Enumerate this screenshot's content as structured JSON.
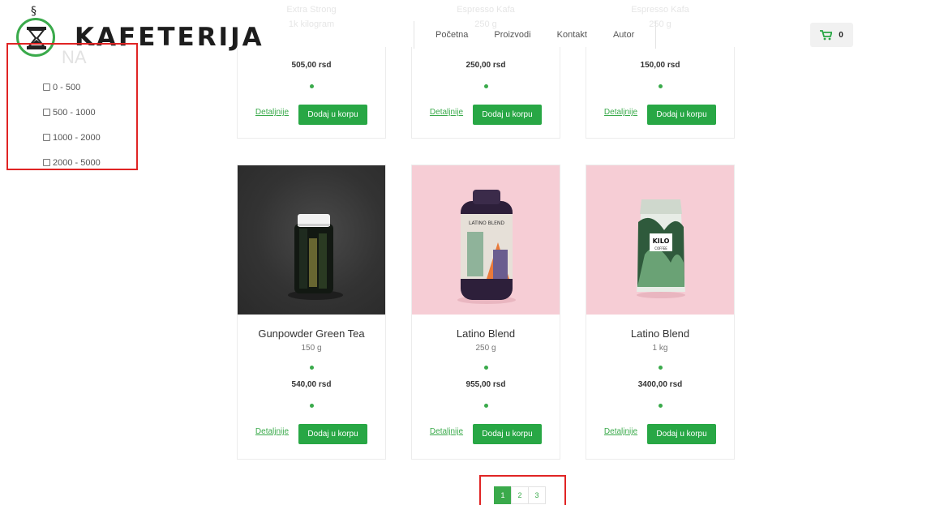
{
  "brand": {
    "logo_text": "KAFETERIJA",
    "logo_icon": "coffee-hourglass-icon",
    "accent": "#3aaa4b"
  },
  "nav": {
    "items": [
      "Početna",
      "Proizvodi",
      "Kontakt",
      "Autor"
    ]
  },
  "cart": {
    "icon": "cart-icon",
    "count": "0"
  },
  "filter": {
    "heading": "NA",
    "ranges": [
      "0 - 500",
      "500 - 1000",
      "1000 - 2000",
      "2000 - 5000"
    ]
  },
  "faded_top": [
    {
      "name": "Extra Strong",
      "weight": "1k kilogram"
    },
    {
      "name": "Espresso Kafa",
      "weight": "250 g"
    },
    {
      "name": "Espresso Kafa",
      "weight": "250 g"
    }
  ],
  "products_top": [
    {
      "price": "505,00 rsd",
      "details": "Detaljnije",
      "add": "Dodaj u korpu"
    },
    {
      "price": "250,00 rsd",
      "details": "Detaljnije",
      "add": "Dodaj u korpu"
    },
    {
      "price": "150,00 rsd",
      "details": "Detaljnije",
      "add": "Dodaj u korpu"
    }
  ],
  "products": [
    {
      "name": "Gunpowder Green Tea",
      "weight": "150 g",
      "price": "540,00 rsd",
      "details": "Detaljnije",
      "add": "Dodaj u korpu"
    },
    {
      "name": "Latino Blend",
      "weight": "250 g",
      "price": "955,00 rsd",
      "details": "Detaljnije",
      "add": "Dodaj u korpu"
    },
    {
      "name": "Latino Blend",
      "weight": "1 kg",
      "price": "3400,00 rsd",
      "details": "Detaljnije",
      "add": "Dodaj u korpu"
    }
  ],
  "pagination": {
    "pages": [
      "1",
      "2",
      "3"
    ],
    "active": "1"
  },
  "product_images": {
    "latino_bottle_label": "LATINO BLEND",
    "kilo_bag_label": "KILO",
    "kilo_bag_sub": "COFFEE"
  }
}
